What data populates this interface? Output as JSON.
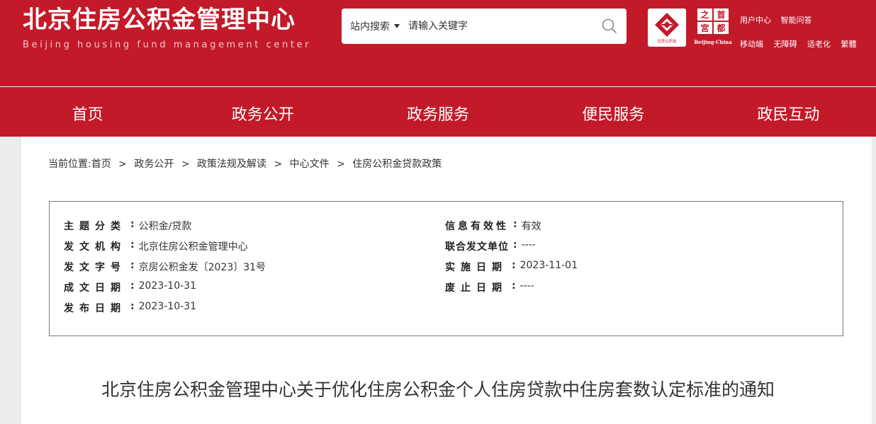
{
  "header": {
    "logo_cn": "北京住房公积金管理中心",
    "logo_en": "Beijing housing fund management center",
    "search": {
      "scope": "站内搜索",
      "placeholder": "请输入关键字"
    },
    "badge1_text": "住房公积金",
    "badge2_chars": [
      "之",
      "首",
      "宮",
      "都"
    ],
    "badge2_en": "Beijing·China",
    "links_row1": [
      "用户中心",
      "智能问答"
    ],
    "links_row2": [
      "移动端",
      "无障碍",
      "适老化",
      "繁體"
    ]
  },
  "nav": [
    "首页",
    "政务公开",
    "政务服务",
    "便民服务",
    "政民互动"
  ],
  "breadcrumb": {
    "prefix": "当前位置:",
    "items": [
      "首页",
      "政务公开",
      "政策法规及解读",
      "中心文件",
      "住房公积金贷款政策"
    ],
    "separator": ">"
  },
  "meta": {
    "left": [
      {
        "key": "主题分类",
        "value": "公积金/贷款"
      },
      {
        "key": "发文机构",
        "value": "北京住房公积金管理中心"
      },
      {
        "key": "发文字号",
        "value": "京房公积金发〔2023〕31号"
      },
      {
        "key": "成文日期",
        "value": "2023-10-31"
      },
      {
        "key": "发布日期",
        "value": "2023-10-31"
      }
    ],
    "right": [
      {
        "key": "信息有效性",
        "value": "有效"
      },
      {
        "key": "联合发文单位",
        "value": "----"
      },
      {
        "key": "实施日期",
        "value": "2023-11-01"
      },
      {
        "key": "废止日期",
        "value": "----"
      }
    ]
  },
  "article": {
    "title": "北京住房公积金管理中心关于优化住房公积金个人住房贷款中住房套数认定标准的通知"
  },
  "colors": {
    "brand_red": "#c21a29",
    "panel_bg": "#ffffff",
    "page_bg": "#ececec"
  }
}
